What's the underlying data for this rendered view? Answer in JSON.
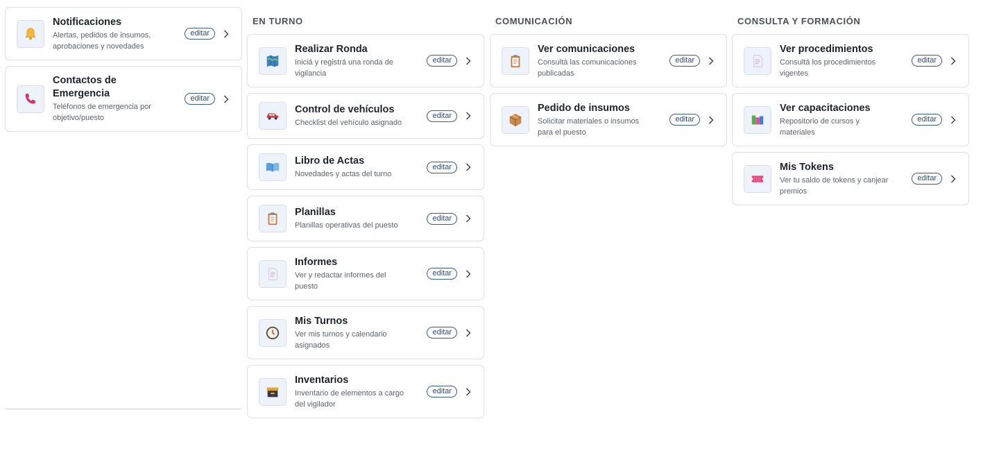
{
  "edit_label": "editar",
  "pinned": [
    {
      "title": "Notificaciones",
      "desc": "Alertas, pedidos de insumos, aprobaciones y novedades",
      "icon": "bell-icon"
    },
    {
      "title": "Contactos de Emergencia",
      "desc": "Teléfonos de emergencia por objetivo/puesto",
      "icon": "phone-icon"
    }
  ],
  "sections": [
    {
      "title": "EN TURNO",
      "items": [
        {
          "title": "Realizar Ronda",
          "desc": "Iniciá y registrá una ronda de vigilancia",
          "icon": "map-icon"
        },
        {
          "title": "Control de vehículos",
          "desc": "Checklist del vehículo asignado",
          "icon": "car-icon"
        },
        {
          "title": "Libro de Actas",
          "desc": "Novedades y actas del turno",
          "icon": "book-icon"
        },
        {
          "title": "Planillas",
          "desc": "Planillas operativas del puesto",
          "icon": "clipboard-icon"
        },
        {
          "title": "Informes",
          "desc": "Ver y redactar informes del puesto",
          "icon": "document-icon"
        },
        {
          "title": "Mis Turnos",
          "desc": "Ver mis turnos y calendario asignados",
          "icon": "clock-icon"
        },
        {
          "title": "Inventarios",
          "desc": "Inventario de elementos a cargo del vigilador",
          "icon": "archive-icon"
        }
      ]
    },
    {
      "title": "COMUNICACIÓN",
      "items": [
        {
          "title": "Ver comunicaciones",
          "desc": "Consultá las comunicaciones publicadas",
          "icon": "clipboard-icon"
        },
        {
          "title": "Pedido de insumos",
          "desc": "Solicitar materiales o insumos para el puesto",
          "icon": "package-icon"
        }
      ]
    },
    {
      "title": "CONSULTA Y FORMACIÓN",
      "items": [
        {
          "title": "Ver procedimientos",
          "desc": "Consultá los procedimientos vigentes",
          "icon": "document-icon"
        },
        {
          "title": "Ver capacitaciones",
          "desc": "Repositorio de cursos y materiales",
          "icon": "books-icon"
        },
        {
          "title": "Mis Tokens",
          "desc": "Ver tu saldo de tokens y canjear premios",
          "icon": "ticket-icon"
        }
      ]
    }
  ]
}
